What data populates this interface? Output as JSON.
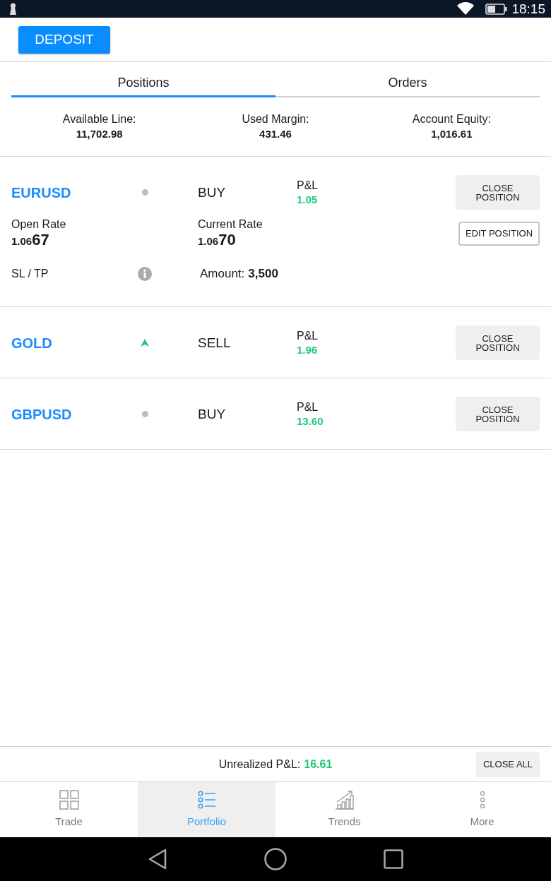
{
  "status_bar": {
    "time": "18:15"
  },
  "header": {
    "deposit_button": "DEPOSIT"
  },
  "tabs": [
    {
      "label": "Positions",
      "selected": true
    },
    {
      "label": "Orders",
      "selected": false
    }
  ],
  "summary": [
    {
      "label": "Available Line:",
      "value": "11,702.98"
    },
    {
      "label": "Used Margin:",
      "value": "431.46"
    },
    {
      "label": "Account Equity:",
      "value": "1,016.61"
    }
  ],
  "positions": [
    {
      "symbol": "EURUSD",
      "kind": "flat",
      "side": "BUY",
      "pnl_label": "P&L",
      "pnl": "1.05",
      "close_button": "CLOSE POSITION",
      "details": {
        "open_rate": {
          "label": "Open Rate",
          "head": "1.06",
          "pips": "67"
        },
        "current_rate": {
          "label": "Current Rate",
          "head": "1.06",
          "pips": "70"
        },
        "edit_button": "EDIT POSITION",
        "sl_tp_label": "SL / TP",
        "amount_label": "Amount:",
        "amount": "3,500"
      }
    },
    {
      "symbol": "GOLD",
      "kind": "up",
      "side": "SELL",
      "pnl_label": "P&L",
      "pnl": "1.96",
      "close_button": "CLOSE POSITION"
    },
    {
      "symbol": "GBPUSD",
      "kind": "flat",
      "side": "BUY",
      "pnl_label": "P&L",
      "pnl": "13.60",
      "close_button": "CLOSE POSITION"
    }
  ],
  "footer": {
    "unrealized_label": "Unrealized P&L:",
    "unrealized_value": "16.61",
    "close_all_button": "CLOSE ALL"
  },
  "bottom_nav": [
    {
      "label": "Trade",
      "selected": false
    },
    {
      "label": "Portfolio",
      "selected": true
    },
    {
      "label": "Trends",
      "selected": false
    },
    {
      "label": "More",
      "selected": false
    }
  ]
}
